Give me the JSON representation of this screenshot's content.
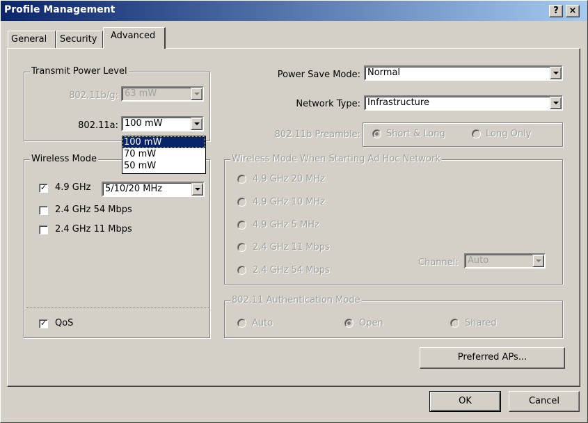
{
  "window": {
    "title": "Profile Management",
    "help_btn": "?",
    "close_btn": "×"
  },
  "tabs": [
    {
      "label": "General",
      "active": false
    },
    {
      "label": "Security",
      "active": false
    },
    {
      "label": "Advanced",
      "active": true
    }
  ],
  "transmit_power": {
    "legend": "Transmit Power Level",
    "bg_label": "802.11b/g:",
    "bg_value": "63 mW",
    "a_label": "802.11a:",
    "a_value": "100 mW",
    "a_options": [
      "100 mW",
      "70 mW",
      "50 mW"
    ],
    "a_options_selected_index": 0
  },
  "wireless_mode": {
    "legend": "Wireless Mode",
    "items": [
      {
        "label": "4.9 GHz",
        "checked": true
      },
      {
        "label": "2.4 GHz 54 Mbps",
        "checked": false
      },
      {
        "label": "2.4 GHz 11 Mbps",
        "checked": false
      }
    ],
    "bandwidth_value": "5/10/20 MHz",
    "qos_label": "QoS",
    "qos_checked": true
  },
  "power_save": {
    "label": "Power Save Mode:",
    "value": "Normal"
  },
  "network_type": {
    "label": "Network Type:",
    "value": "Infrastructure"
  },
  "preamble": {
    "label": "802.11b Preamble:",
    "options": [
      {
        "label": "Short & Long",
        "checked": true
      },
      {
        "label": "Long Only",
        "checked": false
      }
    ]
  },
  "adhoc_mode": {
    "legend": "Wireless Mode When Starting Ad Hoc Network",
    "options": [
      {
        "label": "4.9 GHz 20 MHz"
      },
      {
        "label": "4.9 GHz 10 MHz"
      },
      {
        "label": "4.9 GHz 5 MHz"
      },
      {
        "label": "2.4 GHz 11 Mbps"
      },
      {
        "label": "2.4 GHz 54 Mbps"
      }
    ],
    "channel_label": "Channel:",
    "channel_value": "Auto"
  },
  "auth_mode": {
    "legend": "802.11 Authentication Mode",
    "options": [
      {
        "label": "Auto",
        "checked": false
      },
      {
        "label": "Open",
        "checked": true
      },
      {
        "label": "Shared",
        "checked": false
      }
    ]
  },
  "buttons": {
    "preferred_aps": "Preferred APs...",
    "ok": "OK",
    "cancel": "Cancel"
  },
  "glyphs": {
    "check": "✓"
  },
  "colors": {
    "titlebar_start": "#0a246a",
    "titlebar_end": "#a6caf0",
    "face": "#d4d0c8",
    "selection": "#0a246a"
  }
}
